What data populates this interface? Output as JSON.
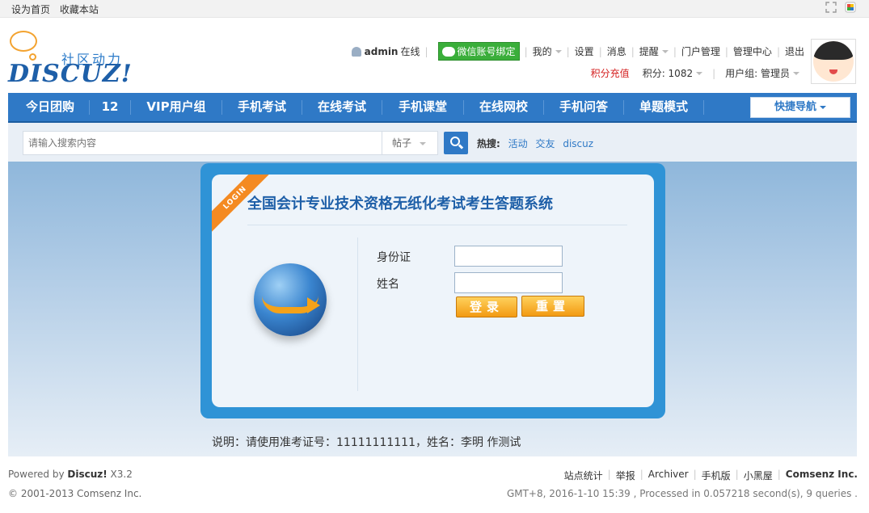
{
  "topbar": {
    "set_home": "设为首页",
    "bookmark": "收藏本站"
  },
  "logo": {
    "cn": "社区动力",
    "en": "DISCUZ!"
  },
  "user": {
    "name": "admin",
    "status": "在线",
    "wechat_bind": "微信账号绑定",
    "links": [
      "我的",
      "设置",
      "消息",
      "提醒",
      "门户管理",
      "管理中心",
      "退出"
    ],
    "recharge": "积分充值",
    "credits": "积分: 1082",
    "group": "用户组: 管理员"
  },
  "nav": {
    "items": [
      "今日团购",
      "12",
      "VIP用户组",
      "手机考试",
      "在线考试",
      "手机课堂",
      "在线网校",
      "手机问答",
      "单题模式"
    ],
    "quick": "快捷导航"
  },
  "search": {
    "placeholder": "请输入搜索内容",
    "type": "帖子",
    "hot_label": "热搜:",
    "hot": [
      "活动",
      "交友",
      "discuz"
    ]
  },
  "login": {
    "ribbon": "LOGIN",
    "title": "全国会计专业技术资格无纸化考试考生答题系统",
    "id_label": "身份证",
    "name_label": "姓名",
    "login_button": "登录",
    "reset_button": "重置"
  },
  "note": "说明：请使用准考证号：11111111111，姓名：李明 作测试",
  "footer": {
    "powered_prefix": "Powered by ",
    "powered_brand": "Discuz!",
    "powered_version": " X3.2",
    "copyright": "© 2001-2013 Comsenz Inc.",
    "links": [
      "站点统计",
      "举报",
      "Archiver",
      "手机版",
      "小黑屋"
    ],
    "company": "Comsenz Inc.",
    "stats": "GMT+8, 2016-1-10 15:39 , Processed in 0.057218 second(s), 9 queries ."
  },
  "colors": {
    "nav": "#2f79c6",
    "panel": "#2f93d6",
    "accent_red": "#d41f1f",
    "button_orange": "#f29a12"
  }
}
